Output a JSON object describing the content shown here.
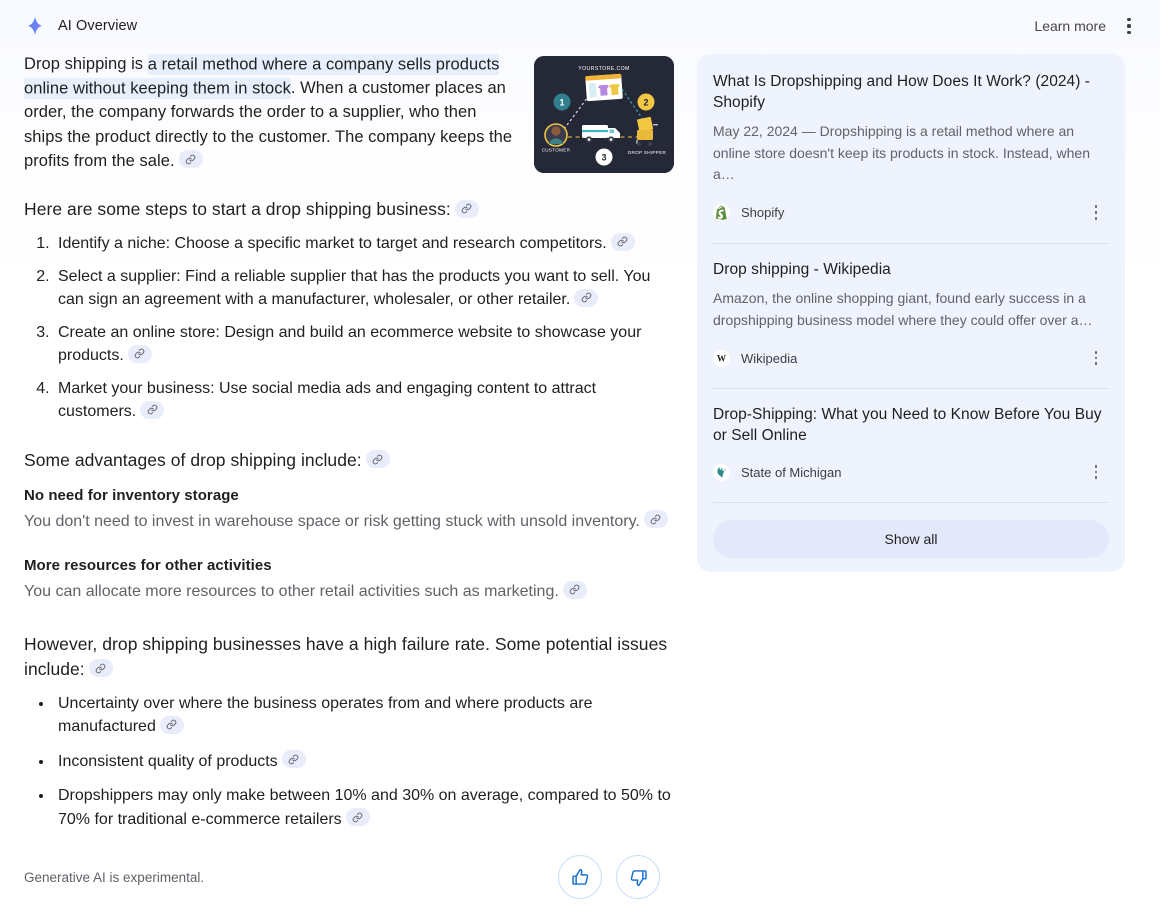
{
  "header": {
    "title": "AI Overview",
    "sparkle_icon": "sparkle-icon",
    "learn_more": "Learn more",
    "menu_icon": "kebab-menu-icon"
  },
  "colors": {
    "page_bg": "#ffffff",
    "highlight": "#e7eefc",
    "chip_bg": "#e8ecfb",
    "card_bg": "#eff3fd",
    "show_all_bg": "#e3e9fb",
    "accent_blue": "#1a73e8",
    "muted_text": "#5f6368",
    "divider": "#d6e4f2",
    "shopify_green": "#5e8e3e",
    "michigan_teal": "#2e8b8b"
  },
  "main": {
    "intro": {
      "before_highlight": "Drop shipping is ",
      "highlight": "a retail method where a company sells products online without keeping them in stock",
      "after_highlight": ". When a customer places an order, the company forwards the order to a supplier, who then ships the product directly to the customer. The company keeps the profits from the sale.",
      "thumbnail": {
        "alt": "dropshipping-flow-diagram",
        "labels": {
          "store": "YOURSTORE.COM",
          "customer": "CUSTOMER",
          "shipper": "DROP SHIPPER",
          "step1": "1",
          "step2": "2",
          "step3": "3"
        }
      }
    },
    "steps_heading": "Here are some steps to start a drop shipping business:",
    "steps": [
      "Identify a niche: Choose a specific market to target and research competitors.",
      "Select a supplier: Find a reliable supplier that has the products you want to sell. You can sign an agreement with a manufacturer, wholesaler, or other retailer.",
      "Create an online store: Design and build an ecommerce website to showcase your products.",
      "Market your business: Use social media ads and engaging content to attract customers."
    ],
    "advantages_heading": "Some advantages of drop shipping include:",
    "advantages": [
      {
        "title": "No need for inventory storage",
        "body": "You don't need to invest in warehouse space or risk getting stuck with unsold inventory."
      },
      {
        "title": "More resources for other activities",
        "body": "You can allocate more resources to other retail activities such as marketing."
      }
    ],
    "issues_heading": "However, drop shipping businesses have a high failure rate. Some potential issues include:",
    "issues": [
      "Uncertainty over where the business operates from and where products are manufactured",
      "Inconsistent quality of products",
      "Dropshippers may only make between 10% and 30% on average, compared to 50% to 70% for traditional e-commerce retailers"
    ],
    "link_chip_icon": "link-chip-icon"
  },
  "footer": {
    "disclaimer": "Generative AI is experimental.",
    "thumbs_up_icon": "thumbs-up-icon",
    "thumbs_down_icon": "thumbs-down-icon"
  },
  "sidebar": {
    "sources": [
      {
        "title": "What Is Dropshipping and How Does It Work? (2024) - Shopify",
        "snippet": "May 22, 2024 — Dropshipping is a retail method where an online store doesn't keep its products in stock. Instead, when a…",
        "source_name": "Shopify",
        "favicon": "shopify-icon"
      },
      {
        "title": "Drop shipping - Wikipedia",
        "snippet": "Amazon, the online shopping giant, found early success in a dropshipping business model where they could offer over a…",
        "source_name": "Wikipedia",
        "favicon": "wikipedia-icon"
      },
      {
        "title": "Drop-Shipping: What you Need to Know Before You Buy or Sell Online",
        "snippet": "",
        "source_name": "State of Michigan",
        "favicon": "michigan-icon"
      }
    ],
    "show_all": "Show all"
  }
}
